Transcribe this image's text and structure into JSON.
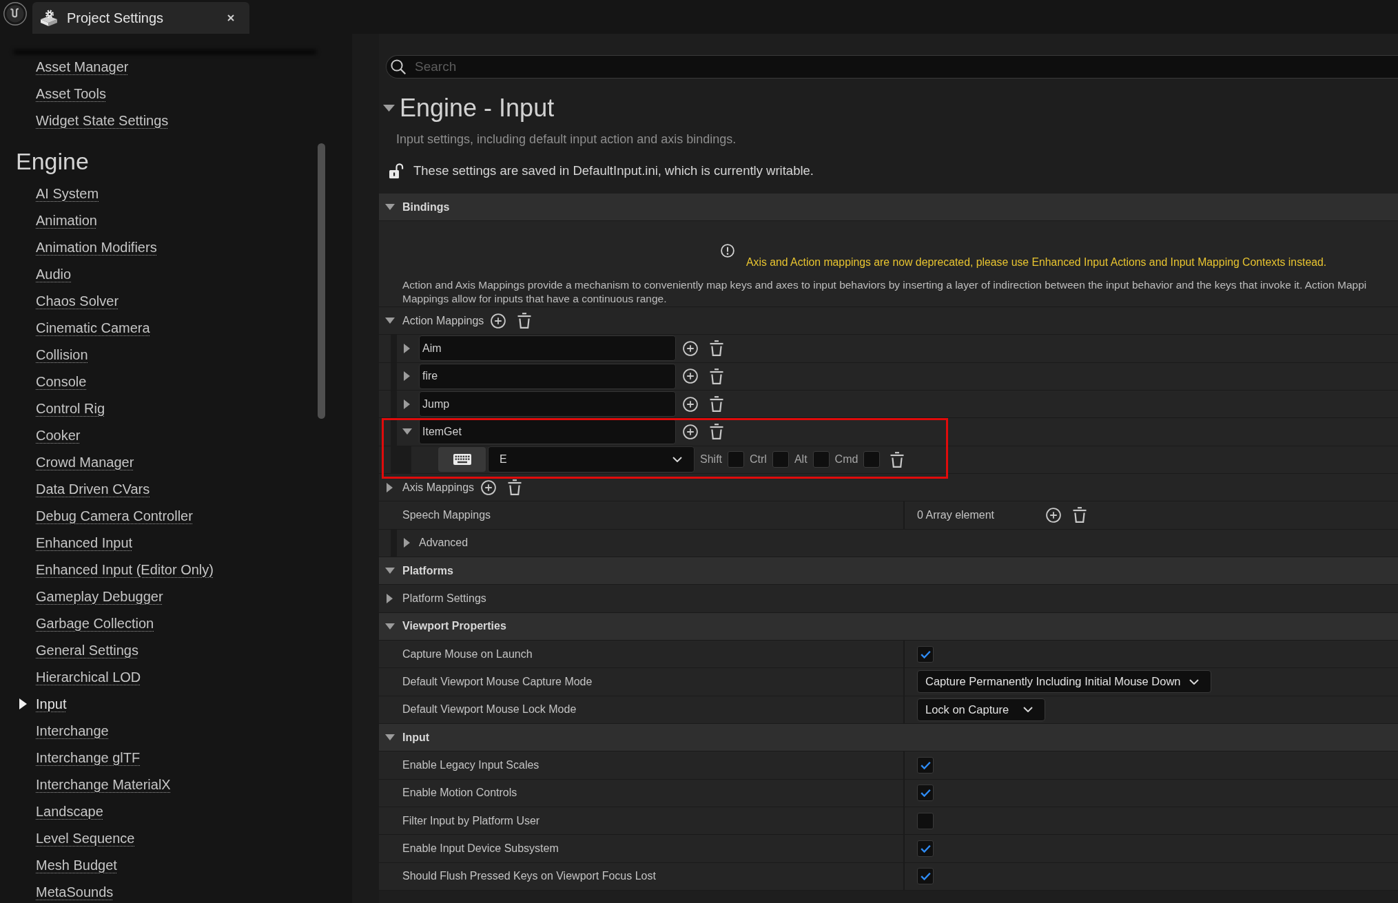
{
  "tab": {
    "title": "Project Settings"
  },
  "sidebar": {
    "groups": [
      {
        "items": [
          {
            "label": "Asset Manager",
            "selected": false
          },
          {
            "label": "Asset Tools",
            "selected": false
          },
          {
            "label": "Widget State Settings",
            "selected": false
          }
        ]
      },
      {
        "title": "Engine",
        "items": [
          {
            "label": "AI System",
            "selected": false
          },
          {
            "label": "Animation",
            "selected": false
          },
          {
            "label": "Animation Modifiers",
            "selected": false
          },
          {
            "label": "Audio",
            "selected": false
          },
          {
            "label": "Chaos Solver",
            "selected": false
          },
          {
            "label": "Cinematic Camera",
            "selected": false
          },
          {
            "label": "Collision",
            "selected": false
          },
          {
            "label": "Console",
            "selected": false
          },
          {
            "label": "Control Rig",
            "selected": false
          },
          {
            "label": "Cooker",
            "selected": false
          },
          {
            "label": "Crowd Manager",
            "selected": false
          },
          {
            "label": "Data Driven CVars",
            "selected": false
          },
          {
            "label": "Debug Camera Controller",
            "selected": false
          },
          {
            "label": "Enhanced Input",
            "selected": false
          },
          {
            "label": "Enhanced Input (Editor Only)",
            "selected": false
          },
          {
            "label": "Gameplay Debugger",
            "selected": false
          },
          {
            "label": "Garbage Collection",
            "selected": false
          },
          {
            "label": "General Settings",
            "selected": false
          },
          {
            "label": "Hierarchical LOD",
            "selected": false
          },
          {
            "label": "Input",
            "selected": true
          },
          {
            "label": "Interchange",
            "selected": false
          },
          {
            "label": "Interchange glTF",
            "selected": false
          },
          {
            "label": "Interchange MaterialX",
            "selected": false
          },
          {
            "label": "Landscape",
            "selected": false
          },
          {
            "label": "Level Sequence",
            "selected": false
          },
          {
            "label": "Mesh Budget",
            "selected": false
          },
          {
            "label": "MetaSounds",
            "selected": false
          }
        ]
      }
    ]
  },
  "search": {
    "placeholder": "Search"
  },
  "section": {
    "title": "Engine - Input",
    "expanded": true,
    "description": "Input settings, including default input action and axis bindings.",
    "save_note": "These settings are saved in DefaultInput.ini, which is currently writable."
  },
  "categories": [
    {
      "title": "Bindings",
      "expanded": true,
      "warning": "Axis and Action mappings are now deprecated, please use Enhanced Input Actions and Input Mapping Contexts instead.",
      "note": "Action and Axis Mappings provide a mechanism to conveniently map keys and axes to input behaviors by inserting a layer of indirection between the input behavior and the keys that invoke it. Action Mappi\nMappings allow for inputs that have a continuous range.",
      "rows": [
        {
          "kind": "array",
          "label": "Action Mappings",
          "expanded": true,
          "items": [
            {
              "name": "Aim",
              "expanded": false,
              "highlighted": false
            },
            {
              "name": "fire",
              "expanded": false,
              "highlighted": false
            },
            {
              "name": "Jump",
              "expanded": false,
              "highlighted": false
            },
            {
              "name": "ItemGet",
              "expanded": true,
              "highlighted": true,
              "keys": [
                {
                  "key": "E",
                  "modifiers": [
                    {
                      "label": "Shift",
                      "checked": false
                    },
                    {
                      "label": "Ctrl",
                      "checked": false
                    },
                    {
                      "label": "Alt",
                      "checked": false
                    },
                    {
                      "label": "Cmd",
                      "checked": false
                    }
                  ]
                }
              ]
            }
          ]
        },
        {
          "kind": "array",
          "label": "Axis Mappings",
          "expanded": false
        },
        {
          "kind": "count",
          "label": "Speech Mappings",
          "value": "0 Array element"
        },
        {
          "kind": "advanced",
          "label": "Advanced",
          "expanded": false
        }
      ]
    },
    {
      "title": "Platforms",
      "expanded": true,
      "rows": [
        {
          "kind": "group",
          "label": "Platform Settings",
          "expanded": false
        }
      ]
    },
    {
      "title": "Viewport Properties",
      "expanded": true,
      "rows": [
        {
          "kind": "checkbox",
          "label": "Capture Mouse on Launch",
          "checked": true
        },
        {
          "kind": "dropdown",
          "label": "Default Viewport Mouse Capture Mode",
          "value": "Capture Permanently Including Initial Mouse Down"
        },
        {
          "kind": "dropdown",
          "label": "Default Viewport Mouse Lock Mode",
          "value": "Lock on Capture"
        }
      ]
    },
    {
      "title": "Input",
      "expanded": true,
      "rows": [
        {
          "kind": "checkbox",
          "label": "Enable Legacy Input Scales",
          "checked": true
        },
        {
          "kind": "checkbox",
          "label": "Enable Motion Controls",
          "checked": true
        },
        {
          "kind": "checkbox",
          "label": "Filter Input by Platform User",
          "checked": false
        },
        {
          "kind": "checkbox",
          "label": "Enable Input Device Subsystem",
          "checked": true
        },
        {
          "kind": "checkbox",
          "label": "Should Flush Pressed Keys on Viewport Focus Lost",
          "checked": true
        }
      ]
    }
  ]
}
